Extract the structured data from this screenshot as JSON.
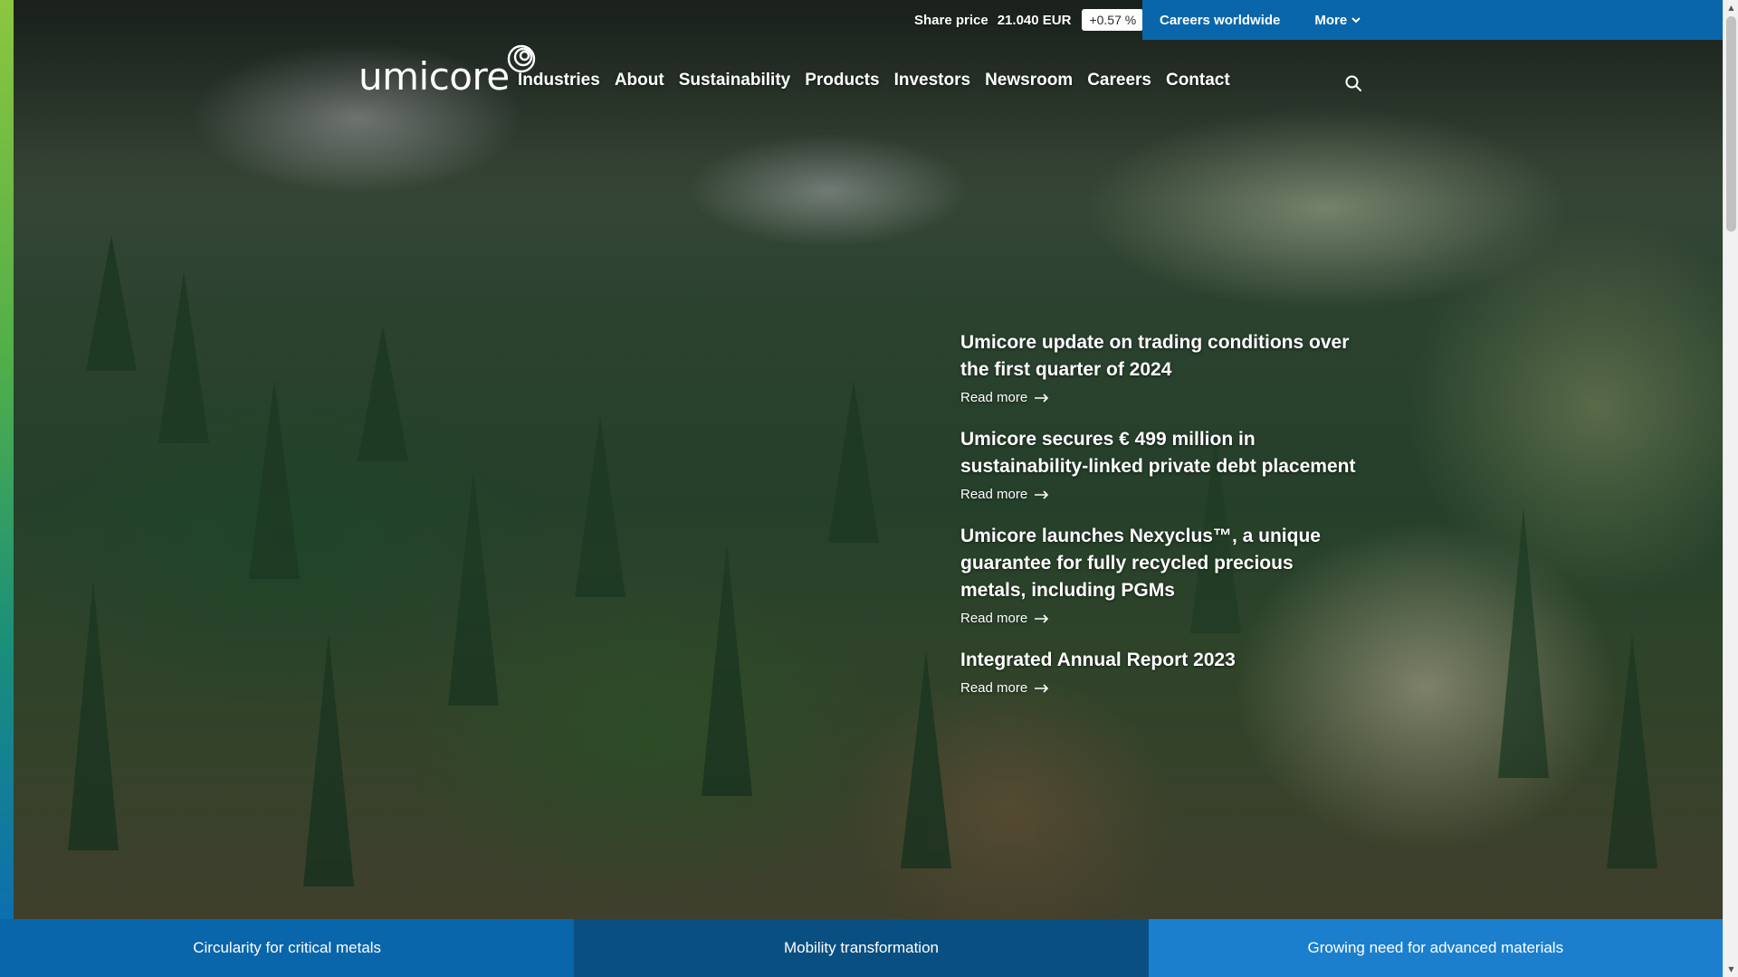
{
  "colors": {
    "accent_blue": "#0a66ab",
    "tab_dark_blue": "#0a4f82",
    "tab_light_blue": "#1b7fce",
    "gradient_strip_top": "#8cc63f",
    "gradient_strip_bottom": "#0d6fb0"
  },
  "topbar": {
    "share_label": "Share price",
    "share_value": "21.040 EUR",
    "share_change": "+0.57 %",
    "careers_worldwide": "Careers worldwide",
    "more_label": "More",
    "more_icon": "chevron-down-icon"
  },
  "brand": {
    "logo_text": "umicore",
    "logo_icon": "spiral-logo-icon"
  },
  "nav": {
    "items": [
      {
        "label": "Industries"
      },
      {
        "label": "About"
      },
      {
        "label": "Sustainability"
      },
      {
        "label": "Products"
      },
      {
        "label": "Investors"
      },
      {
        "label": "Newsroom"
      },
      {
        "label": "Careers"
      },
      {
        "label": "Contact"
      }
    ],
    "search_icon": "search-icon"
  },
  "news": {
    "read_more": "Read more",
    "items": [
      {
        "title": "Umicore update on trading conditions over the first quarter of 2024"
      },
      {
        "title": "Umicore secures € 499 million in sustainability-linked private debt placement"
      },
      {
        "title": "Umicore launches Nexyclus™, a unique guarantee for fully recycled precious metals, including PGMs"
      },
      {
        "title": "Integrated Annual Report 2023"
      }
    ]
  },
  "bottom_tabs": [
    {
      "label": "Circularity for critical metals"
    },
    {
      "label": "Mobility transformation"
    },
    {
      "label": "Growing need for advanced materials"
    }
  ]
}
